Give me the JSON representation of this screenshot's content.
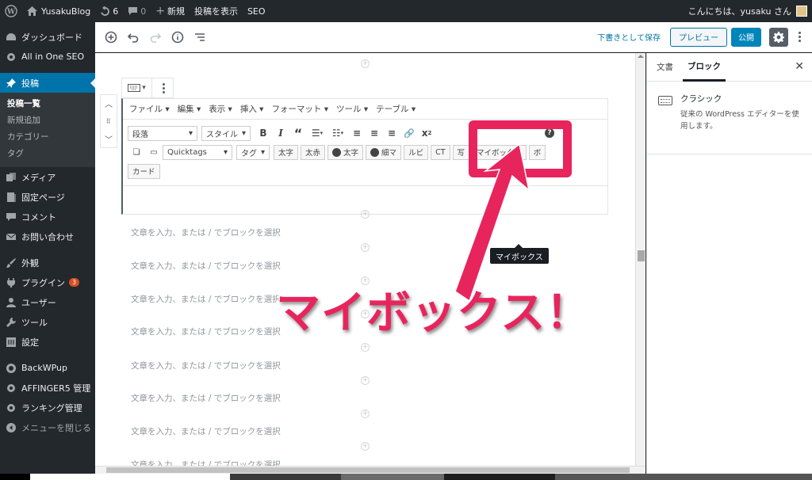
{
  "adminbar": {
    "site_name": "YusakuBlog",
    "updates_count": "6",
    "comments_count": "0",
    "new_label": "新規",
    "view_post_label": "投稿を表示",
    "seo_label": "SEO",
    "greeting": "こんにちは、yusaku さん"
  },
  "sidebar": {
    "dashboard": "ダッシュボード",
    "aioseo": "All in One SEO",
    "posts": "投稿",
    "posts_sub": [
      "投稿一覧",
      "新規追加",
      "カテゴリー",
      "タグ"
    ],
    "media": "メディア",
    "pages": "固定ページ",
    "comments": "コメント",
    "contact": "お問い合わせ",
    "appearance": "外観",
    "plugins": "プラグイン",
    "plugins_badge": "3",
    "users": "ユーザー",
    "tools": "ツール",
    "settings": "設定",
    "backwpup": "BackWPup",
    "affingers": "AFFINGER5 管理",
    "ranking": "ランキング管理",
    "collapse": "メニューを閉じる"
  },
  "header": {
    "save_draft": "下書きとして保存",
    "preview": "プレビュー",
    "publish": "公開"
  },
  "classic": {
    "menubar": [
      "ファイル ▾",
      "編集 ▾",
      "表示 ▾",
      "挿入 ▾",
      "フォーマット ▾",
      "ツール ▾",
      "テーブル ▾"
    ],
    "format_select": "段落",
    "style_select": "スタイル",
    "quicktags_select": "Quicktags",
    "tag_select": "タグ",
    "buttons": [
      "太字",
      "太赤",
      "太字",
      "細マ",
      "ルビ",
      "CT",
      "写",
      "マイボックス",
      "ボ",
      "カード"
    ]
  },
  "placeholders": [
    "文章を入力、または / でブロックを選択",
    "文章を入力、または / でブロックを選択",
    "文章を入力、または / でブロックを選択",
    "文章を入力、または / でブロックを選択",
    "文章を入力、または / でブロックを選択",
    "文章を入力、または / でブロックを選択",
    "文章を入力、または / でブロックを選択",
    "文章を入力、または / でブロックを選択"
  ],
  "tooltip": "マイボックス",
  "annotation": "マイボックス！",
  "settings_panel": {
    "tab_document": "文書",
    "tab_block": "ブロック",
    "block_title": "クラシック",
    "block_desc": "従来の WordPress エディターを使用します。"
  },
  "colors": {
    "accent": "#0073aa",
    "annotation": "#e8245d"
  }
}
